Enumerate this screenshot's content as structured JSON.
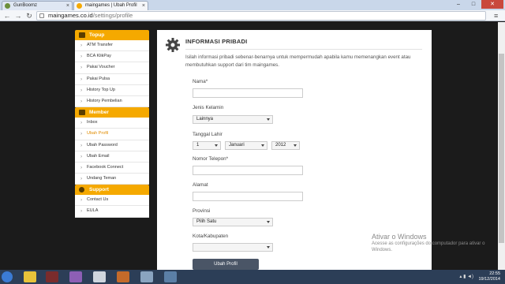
{
  "browser": {
    "tabs": [
      {
        "title": "GunBoomz",
        "active": false
      },
      {
        "title": "maingames | Ubah Profil",
        "active": true
      }
    ],
    "url_host": "maingames.co.id",
    "url_path": "/settings/profile"
  },
  "sidebar": {
    "sections": [
      {
        "title": "Topup",
        "items": [
          "ATM Transfer",
          "BCA KlikPay",
          "Pakai Voucher",
          "Pakai Pulsa",
          "History Top Up",
          "History Pembelian"
        ]
      },
      {
        "title": "Member",
        "items": [
          "Inbox",
          "Ubah Profil",
          "Ubah Password",
          "Ubah Email",
          "Facebook Connect",
          "Undang Teman"
        ]
      },
      {
        "title": "Support",
        "items": [
          "Contact Us",
          "EULA"
        ]
      }
    ],
    "active_item": "Ubah Profil"
  },
  "main": {
    "title": "INFORMASI PRIBADI",
    "intro": "Isilah informasi pribadi sebenar-benarnya untuk mempermudah apabila kamu memenangkan event atau membutuhkan support dari tim maingames.",
    "fields": {
      "nama_label": "Nama*",
      "gender_label": "Jenis Kelamin",
      "gender_value": "Lainnya",
      "dob_label": "Tanggal Lahir",
      "dob_day": "1",
      "dob_month": "Januari",
      "dob_year": "2012",
      "phone_label": "Nomor Telepon*",
      "address_label": "Alamat",
      "province_label": "Provinsi",
      "province_value": "Pilih Satu",
      "city_label": "Kota/Kabupaten",
      "city_value": ""
    },
    "submit_label": "Ubah Profil"
  },
  "watermark": {
    "title": "Ativar o Windows",
    "subtitle": "Acesse as configurações do computador para ativar o Windows."
  },
  "taskbar": {
    "time": "22:55",
    "date": "19/12/2014"
  },
  "colors": {
    "accent": "#f5a900",
    "button": "#4a5566"
  }
}
